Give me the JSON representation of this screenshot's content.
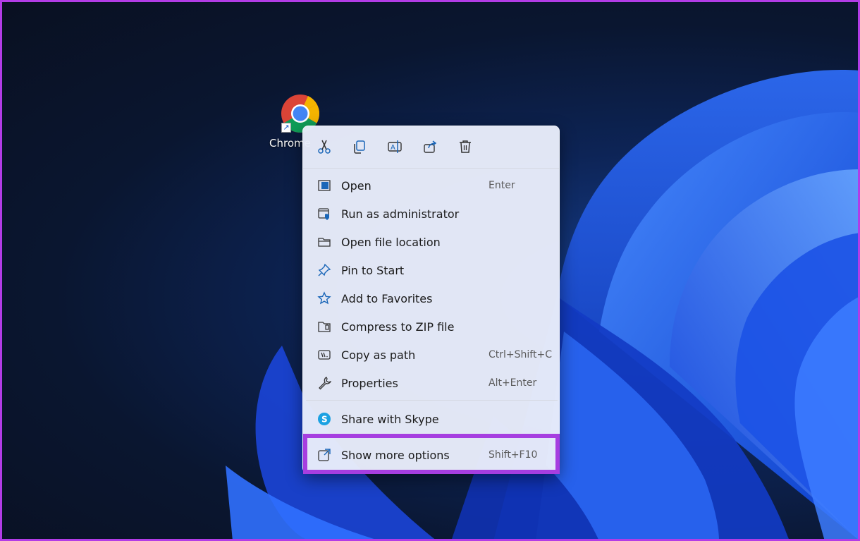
{
  "desktop": {
    "icon_label": "Chrome"
  },
  "menu": {
    "quick_actions": [
      {
        "name": "cut",
        "icon": "scissors-icon"
      },
      {
        "name": "copy",
        "icon": "copy-icon"
      },
      {
        "name": "rename",
        "icon": "rename-icon"
      },
      {
        "name": "share",
        "icon": "share-icon"
      },
      {
        "name": "delete",
        "icon": "trash-icon"
      }
    ],
    "items": [
      {
        "label": "Open",
        "accel": "Enter",
        "icon": "open-window-icon"
      },
      {
        "label": "Run as administrator",
        "accel": "",
        "icon": "admin-shield-icon"
      },
      {
        "label": "Open file location",
        "accel": "",
        "icon": "folder-icon"
      },
      {
        "label": "Pin to Start",
        "accel": "",
        "icon": "pin-icon"
      },
      {
        "label": "Add to Favorites",
        "accel": "",
        "icon": "star-icon"
      },
      {
        "label": "Compress to ZIP file",
        "accel": "",
        "icon": "zip-folder-icon"
      },
      {
        "label": "Copy as path",
        "accel": "Ctrl+Shift+C",
        "icon": "path-icon"
      },
      {
        "label": "Properties",
        "accel": "Alt+Enter",
        "icon": "wrench-icon"
      }
    ],
    "share_item": {
      "label": "Share with Skype",
      "icon": "skype-icon"
    },
    "more_item": {
      "label": "Show more options",
      "accel": "Shift+F10",
      "icon": "expand-icon"
    }
  },
  "colors": {
    "highlight": "#a63ee0",
    "icon_blue": "#1a66b8",
    "skype": "#1ba1e2"
  }
}
